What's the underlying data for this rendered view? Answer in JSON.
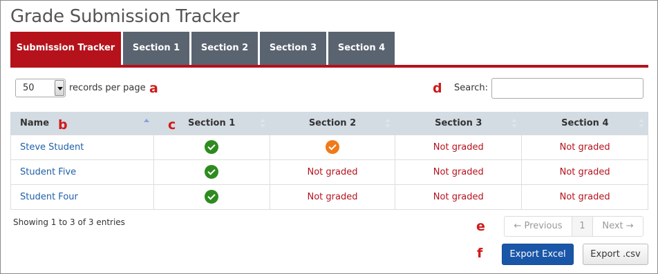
{
  "page": {
    "title": "Grade Submission Tracker"
  },
  "tabs": [
    {
      "label": "Submission Tracker",
      "active": true
    },
    {
      "label": "Section 1"
    },
    {
      "label": "Section 2"
    },
    {
      "label": "Section 3"
    },
    {
      "label": "Section 4"
    }
  ],
  "controls": {
    "per_page_value": "50",
    "per_page_label": "records per page",
    "search_label": "Search:",
    "search_value": ""
  },
  "annotations": {
    "a": "a",
    "b": "b",
    "c": "c",
    "d": "d",
    "e": "e",
    "f": "f"
  },
  "table": {
    "columns": [
      "Name",
      "Section 1",
      "Section 2",
      "Section 3",
      "Section 4"
    ],
    "rows": [
      {
        "name": "Steve Student",
        "cells": [
          {
            "type": "check",
            "color": "#2e8b1f"
          },
          {
            "type": "check",
            "color": "#f07a1a"
          },
          {
            "type": "text",
            "text": "Not graded"
          },
          {
            "type": "text",
            "text": "Not graded"
          }
        ]
      },
      {
        "name": "Student Five",
        "cells": [
          {
            "type": "check",
            "color": "#2e8b1f"
          },
          {
            "type": "text",
            "text": "Not graded"
          },
          {
            "type": "text",
            "text": "Not graded"
          },
          {
            "type": "text",
            "text": "Not graded"
          }
        ]
      },
      {
        "name": "Student Four",
        "cells": [
          {
            "type": "check",
            "color": "#2e8b1f"
          },
          {
            "type": "text",
            "text": "Not graded"
          },
          {
            "type": "text",
            "text": "Not graded"
          },
          {
            "type": "text",
            "text": "Not graded"
          }
        ]
      }
    ]
  },
  "footer": {
    "info": "Showing 1 to 3 of 3 entries",
    "prev": "← Previous",
    "page": "1",
    "next": "Next →",
    "export_excel": "Export Excel",
    "export_csv": "Export .csv"
  },
  "colors": {
    "brand_red": "#b5121b",
    "tab_gray": "#5a6470",
    "header_bg": "#d3dbe3",
    "link_blue": "#1f5fa8",
    "primary_button": "#1a56a8"
  }
}
